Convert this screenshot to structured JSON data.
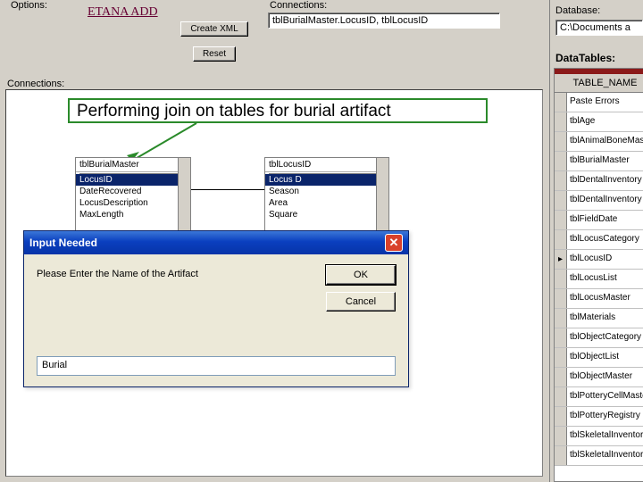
{
  "labels": {
    "options": "Options:",
    "connections_top": "Connections:",
    "connections_left": "Connections:",
    "database": "Database:"
  },
  "app_title": "ETANA ADD",
  "buttons": {
    "create_xml": "Create XML",
    "reset": "Reset"
  },
  "connections_value": "tblBurialMaster.LocusID, tblLocusID",
  "database_path": "C:\\Documents a",
  "callout_text": "Performing join on tables for burial artifact",
  "table1": {
    "title": "tblBurialMaster",
    "fields": [
      "LocusID",
      "DateRecovered",
      "LocusDescription",
      "MaxLength"
    ],
    "selected_index": 0
  },
  "table2": {
    "title": "tblLocusID",
    "fields": [
      "Locus D",
      "Season",
      "Area",
      "Square"
    ],
    "selected_index": 0
  },
  "dialog": {
    "title": "Input Needed",
    "prompt": "Please Enter the Name of the Artifact",
    "ok": "OK",
    "cancel": "Cancel",
    "value": "Burial"
  },
  "right": {
    "data_tables_label": "DataTables:",
    "column_header": "TABLE_NAME",
    "rows": [
      "Paste Errors",
      "tblAge",
      "tblAnimalBoneMast",
      "tblBurialMaster",
      "tblDentalInventory",
      "tblDentalInventory",
      "tblFieldDate",
      "tblLocusCategory",
      "tblLocusID",
      "tblLocusList",
      "tblLocusMaster",
      "tblMaterials",
      "tblObjectCategory",
      "tblObjectList",
      "tblObjectMaster",
      "tblPotteryCellMaste",
      "tblPotteryRegistry",
      "tblSkeletalInventor",
      "tblSkeletalInventor"
    ],
    "current_row_index": 8
  }
}
